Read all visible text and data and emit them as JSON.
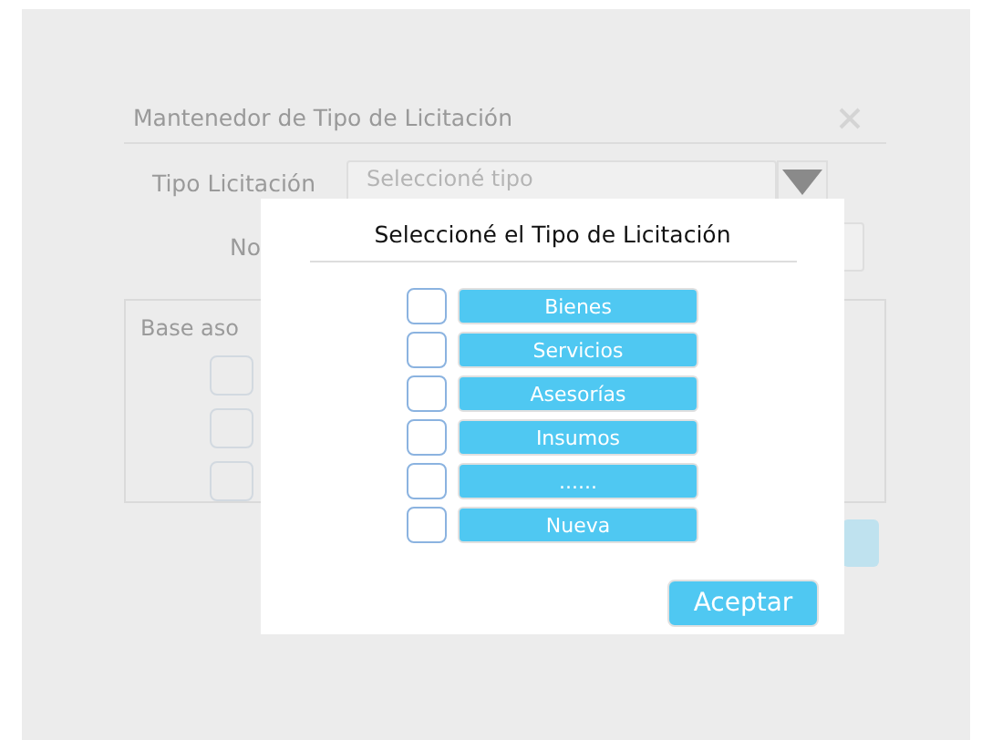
{
  "background_dialog": {
    "title": "Mantenedor de Tipo de Licitación",
    "fields": [
      {
        "kind": "select",
        "label": "Tipo Licitación",
        "placeholder": "Seleccioné  tipo"
      },
      {
        "kind": "text",
        "label": "No"
      }
    ],
    "group": {
      "title": "Base aso",
      "checkboxes": [
        {
          "checked": false
        },
        {
          "checked": false
        },
        {
          "checked": false
        }
      ]
    }
  },
  "modal": {
    "title": "Seleccioné el Tipo de Licitación",
    "options": [
      {
        "label": "Bienes",
        "checked": false
      },
      {
        "label": "Servicios",
        "checked": false
      },
      {
        "label": "Asesorías",
        "checked": false
      },
      {
        "label": "Insumos",
        "checked": false
      },
      {
        "label": "......",
        "checked": false
      },
      {
        "label": "Nueva",
        "checked": false
      }
    ],
    "button": "Aceptar"
  }
}
